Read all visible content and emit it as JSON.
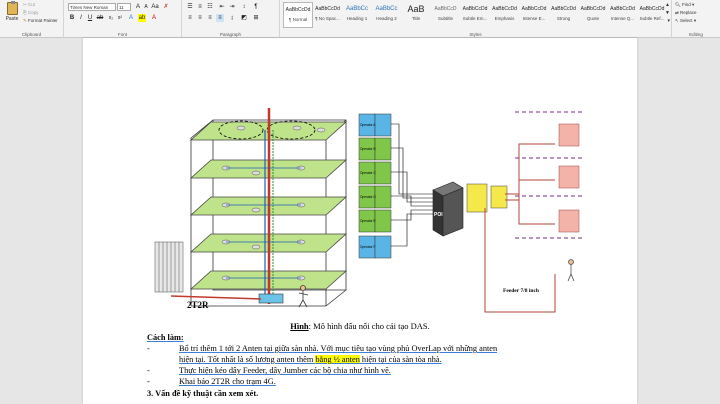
{
  "ribbon": {
    "clipboard": {
      "paste": "Paste",
      "cut": "Cut",
      "copy": "Copy",
      "format_painter": "Format Painter",
      "label": "Clipboard"
    },
    "font": {
      "family": "Times New Roman",
      "size": "11",
      "label": "Font"
    },
    "paragraph": {
      "label": "Paragraph"
    },
    "styles": {
      "label": "Styles",
      "items": [
        {
          "preview": "AaBbCcDd",
          "name": "¶ Normal"
        },
        {
          "preview": "AaBbCcDd",
          "name": "¶ No Spac..."
        },
        {
          "preview": "AaBbCc",
          "name": "Heading 1"
        },
        {
          "preview": "AaBbCc",
          "name": "Heading 2"
        },
        {
          "preview": "AaB",
          "name": "Title"
        },
        {
          "preview": "AaBbCcD",
          "name": "Subtitle"
        },
        {
          "preview": "AaBbCcDd",
          "name": "Subtle Em..."
        },
        {
          "preview": "AaBbCcDd",
          "name": "Emphasis"
        },
        {
          "preview": "AaBbCcDd",
          "name": "Intense E..."
        },
        {
          "preview": "AaBbCcDd",
          "name": "Strong"
        },
        {
          "preview": "AaBbCcDd",
          "name": "Quote"
        },
        {
          "preview": "AaBbCcDd",
          "name": "Intense Q..."
        },
        {
          "preview": "AaBbCcDd",
          "name": "Subtle Ref..."
        }
      ]
    },
    "editing": {
      "find": "Find",
      "replace": "Replace",
      "select": "Select",
      "label": "Editing"
    }
  },
  "document": {
    "figure": {
      "label_2t2r": "2T2R",
      "label_poi": "POI",
      "label_feeder": "Feeder 7/8 inch",
      "operator_labels": [
        "Operator A",
        "Operator B",
        "Operator C",
        "Operator D",
        "Operator E",
        "Operator F"
      ]
    },
    "caption": {
      "prefix": "Hình",
      "text": ": Mô hình đấu nối cho cải tạo DAS."
    },
    "section_title": "Cách làm:",
    "bullets": [
      {
        "line1": "Bổ trí thêm 1 tới 2 Anten tại giữa sàn nhà. Với mục tiêu tạo vùng phủ OverLap với những anten",
        "line2a": "hiện tại. Tốt nhất là số lương anten thêm ",
        "line2hl": "bằng ½ anten",
        "line2b": " hiện tại của sàn tòa nhà."
      },
      {
        "text": "Thực hiện kéo dây Feeder, dây Jumber các bộ chia như hình vẽ."
      },
      {
        "text": "Khai báo 2T2R cho trạm 4G."
      }
    ],
    "heading3": "3. Vấn đề kỹ thuật cần xem xét."
  },
  "colors": {
    "floor_green": "#bfe38a",
    "highlight": "#ffff00",
    "ribbon_bg": "#f3f3f3"
  }
}
